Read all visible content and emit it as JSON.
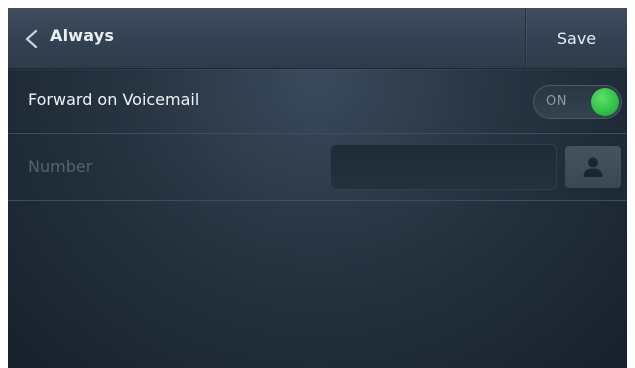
{
  "header": {
    "back_label": "Always",
    "save_label": "Save"
  },
  "forward_voicemail": {
    "label": "Forward on Voicemail",
    "toggle_text": "ON",
    "toggle_state": "on",
    "toggle_color": "#2fbf45"
  },
  "number": {
    "label": "Number",
    "value": "",
    "icon": "contact-person-icon"
  }
}
